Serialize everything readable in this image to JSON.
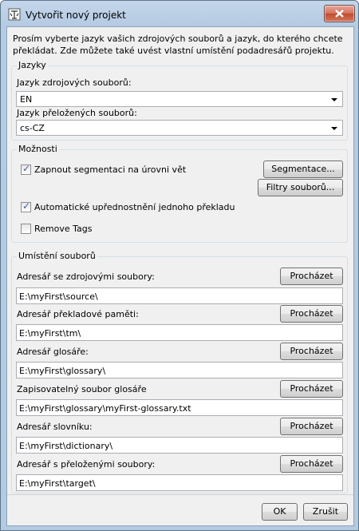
{
  "window": {
    "title": "Vytvořit nový projekt"
  },
  "intro": "Prosím vyberte jazyk vašich zdrojových souborů a jazyk, do kterého chcete překládat. Zde můžete také uvést vlastní umístění podadresářů projektu.",
  "languages": {
    "legend": "Jazyky",
    "source_label": "Jazyk zdrojových souborů:",
    "source_value": "EN",
    "target_label": "Jazyk přeložených souborů:",
    "target_value": "cs-CZ"
  },
  "options": {
    "legend": "Možnosti",
    "segmentation_label": "Zapnout segmentaci na úrovni vět",
    "segmentation_checked": true,
    "segmentation_button": "Segmentace...",
    "filters_button": "Filtry souborů...",
    "auto_label": "Automatické upřednostnění jednoho překladu",
    "auto_checked": true,
    "remove_tags_label": "Remove Tags",
    "remove_tags_checked": false
  },
  "locations": {
    "legend": "Umístění souborů",
    "browse_label": "Procházet",
    "rows": [
      {
        "label": "Adresář se zdrojovými soubory:",
        "value": "E:\\myFirst\\source\\"
      },
      {
        "label": "Adresář překladové paměti:",
        "value": "E:\\myFirst\\tm\\"
      },
      {
        "label": "Adresář glosáře:",
        "value": "E:\\myFirst\\glossary\\"
      },
      {
        "label": "Zapisovatelný soubor glosáře",
        "value": "E:\\myFirst\\glossary\\myFirst-glossary.txt"
      },
      {
        "label": "Adresář slovníku:",
        "value": "E:\\myFirst\\dictionary\\"
      },
      {
        "label": "Adresář s přeloženými soubory:",
        "value": "E:\\myFirst\\target\\"
      }
    ]
  },
  "footer": {
    "ok": "OK",
    "cancel": "Zrušit"
  },
  "colors": {
    "titlebar": "#b5cbe3",
    "client": "#f0f0f0",
    "close": "#c04b2f"
  }
}
